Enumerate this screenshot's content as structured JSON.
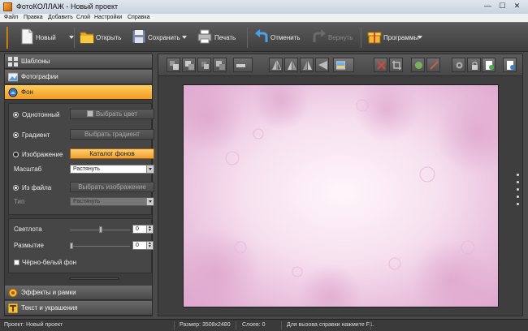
{
  "window": {
    "title": "ФотоКОЛЛАЖ - Новый проект",
    "min_glyph": "—",
    "max_glyph": "☐",
    "close_glyph": "✕"
  },
  "menu": [
    "Файл",
    "Правка",
    "Добавить",
    "Слой",
    "Настройки",
    "Справка"
  ],
  "toolbar": {
    "new_label": "Новый",
    "open_label": "Открыть",
    "save_label": "Сохранить",
    "print_label": "Печать",
    "undo_label": "Отменить",
    "redo_label": "Вернуть",
    "programs_label": "Программы"
  },
  "sidebar": {
    "templates_label": "Шаблоны",
    "photos_label": "Фотографии",
    "background_label": "Фон",
    "effects_label": "Эффекты и рамки",
    "text_label": "Текст и украшения"
  },
  "background": {
    "solid_label": "Однотонный",
    "choose_color_label": "Выбрать цвет",
    "gradient_label": "Градиент",
    "choose_gradient_label": "Выбрать градиент",
    "image_label": "Изображение",
    "catalog_label": "Каталог фонов",
    "scale_label": "Масштаб",
    "scale_value": "Растянуть",
    "from_file_label": "Из файла",
    "choose_image_label": "Выбрать изображение",
    "type_label": "Тип",
    "type_value": "Растянуть",
    "brightness_label": "Светлота",
    "brightness_value": "0",
    "blur_label": "Размытие",
    "blur_value": "0",
    "bw_label": "Чёрно-белый фон"
  },
  "status": {
    "project": "Проект: Новый проект",
    "size": "Размер: 3508x2480",
    "layers": "Слоев: 0",
    "help": "Для вызова справки нажмите F1."
  },
  "colors": {
    "accent": "#f29a20",
    "panel": "#3c3c3c",
    "canvas": "#f6dcee"
  }
}
